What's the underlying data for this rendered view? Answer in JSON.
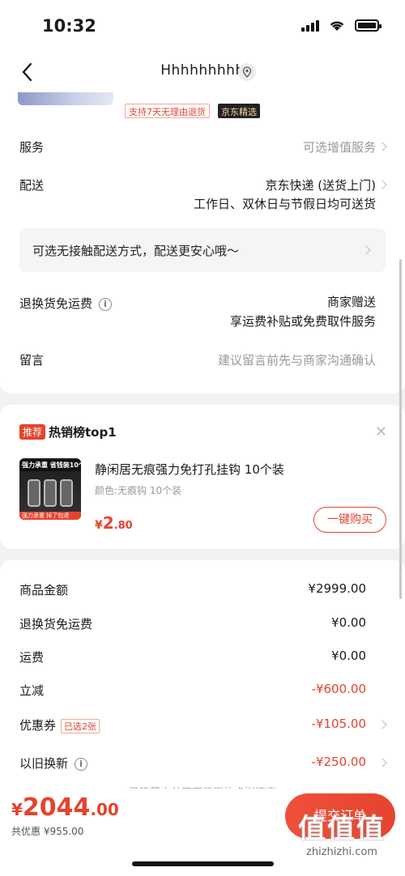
{
  "status_bar": {
    "time": "10:32"
  },
  "nav": {
    "title": "Hhhhhhhhh"
  },
  "product_tags": {
    "return_policy": "支持7天无理由退货",
    "jx": "京东精选"
  },
  "rows": {
    "service_label": "服务",
    "service_value": "可选增值服务",
    "delivery_label": "配送",
    "delivery_value": "京东快递 (送货上门)",
    "delivery_sub": "工作日、双休日与节假日均可送货",
    "contactless": "可选无接触配送方式，配送更安心哦～",
    "return_label": "退换货免运费",
    "return_value": "商家赠送",
    "return_sub": "享运费补贴或免费取件服务",
    "message_label": "留言",
    "message_placeholder": "建议留言前先与商家沟通确认"
  },
  "recommend": {
    "badge": "推荐",
    "title": "热销榜top1",
    "product_name": "静闲居无痕强力免打孔挂钩 10个装",
    "product_spec": "颜色:无痕钩 10个装",
    "price_currency": "¥",
    "price_int": "2",
    "price_dec": ".80",
    "buy_label": "一键购买",
    "image_banner": "强力承重 省钱装10个",
    "image_footer": "强力承重 掉了包退"
  },
  "cost": {
    "goods_label": "商品金额",
    "goods_value": "¥2999.00",
    "return_label": "退换货免运费",
    "return_value": "¥0.00",
    "shipping_label": "运费",
    "shipping_value": "¥0.00",
    "discount_label": "立减",
    "discount_value": "-¥600.00",
    "coupon_label": "优惠券",
    "coupon_tag": "已选2张",
    "coupon_value": "-¥105.00",
    "tradein_label": "以旧换新",
    "tradein_value": "-¥250.00",
    "hidden_note": "已隐藏本单不可使用的虚拟资产"
  },
  "bottom": {
    "currency": "¥",
    "total_int": "2044",
    "total_dec": ".00",
    "saved": "共优惠 ¥955.00",
    "submit_label": "提交订单"
  },
  "watermark": {
    "logo": "值值值",
    "url": "zhizhizhi.com"
  },
  "colors": {
    "accent": "#e5432d",
    "muted": "#999999"
  }
}
